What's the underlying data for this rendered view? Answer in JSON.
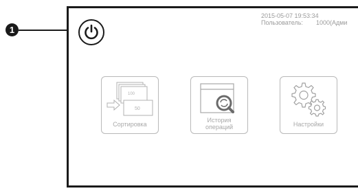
{
  "callout": {
    "number": "1"
  },
  "status": {
    "datetime": "2015-05-07   19:53:34",
    "user_label": "Пользователь:",
    "user_value": "1000(Адми"
  },
  "tiles": [
    {
      "label": "Сортировка",
      "icon": "banknote-sorting-icon",
      "note_small": "100",
      "note_large": "50"
    },
    {
      "label_line1": "История",
      "label_line2": "операций",
      "icon": "history-search-icon"
    },
    {
      "label": "Настройки",
      "icon": "gears-icon"
    }
  ],
  "colors": {
    "frame": "#1a1a1a",
    "tile_border": "#b8b8b8",
    "muted_text": "#a8a8a8"
  }
}
